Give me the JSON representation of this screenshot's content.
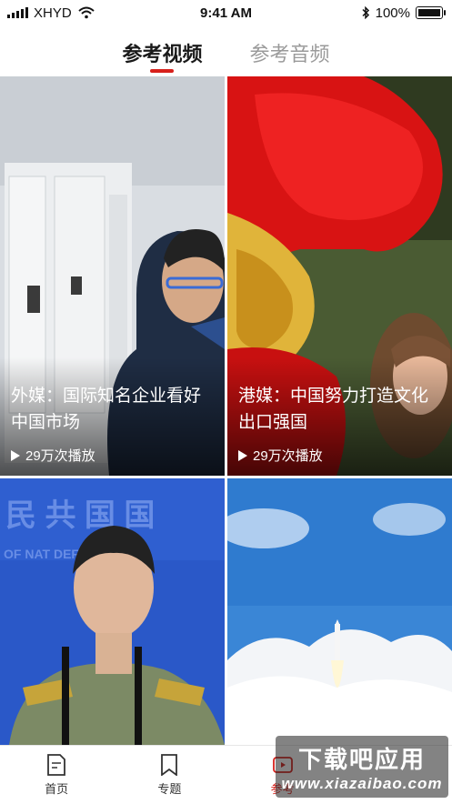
{
  "status_bar": {
    "carrier": "XHYD",
    "time": "9:41 AM",
    "battery": "100%"
  },
  "tabs": [
    {
      "label": "参考视频",
      "active": true
    },
    {
      "label": "参考音频",
      "active": false
    }
  ],
  "videos": [
    {
      "title": "外媒：国际知名企业看好中国市场",
      "plays": "29万次播放"
    },
    {
      "title": "港媒：中国努力打造文化出口强国",
      "plays": "29万次播放"
    },
    {
      "title": "",
      "plays": ""
    },
    {
      "title": "",
      "plays": ""
    }
  ],
  "bottom_nav": [
    {
      "label": "首页",
      "icon": "document-icon"
    },
    {
      "label": "专题",
      "icon": "bookmark-icon"
    },
    {
      "label": "参考",
      "icon": "video-icon",
      "active": true
    },
    {
      "label": "",
      "icon": ""
    }
  ],
  "watermark": {
    "top": "下载吧应用",
    "bottom": "www.xiazaibao.com"
  },
  "colors": {
    "accent": "#d7201b",
    "inactive_tab": "#9a9a9a"
  }
}
